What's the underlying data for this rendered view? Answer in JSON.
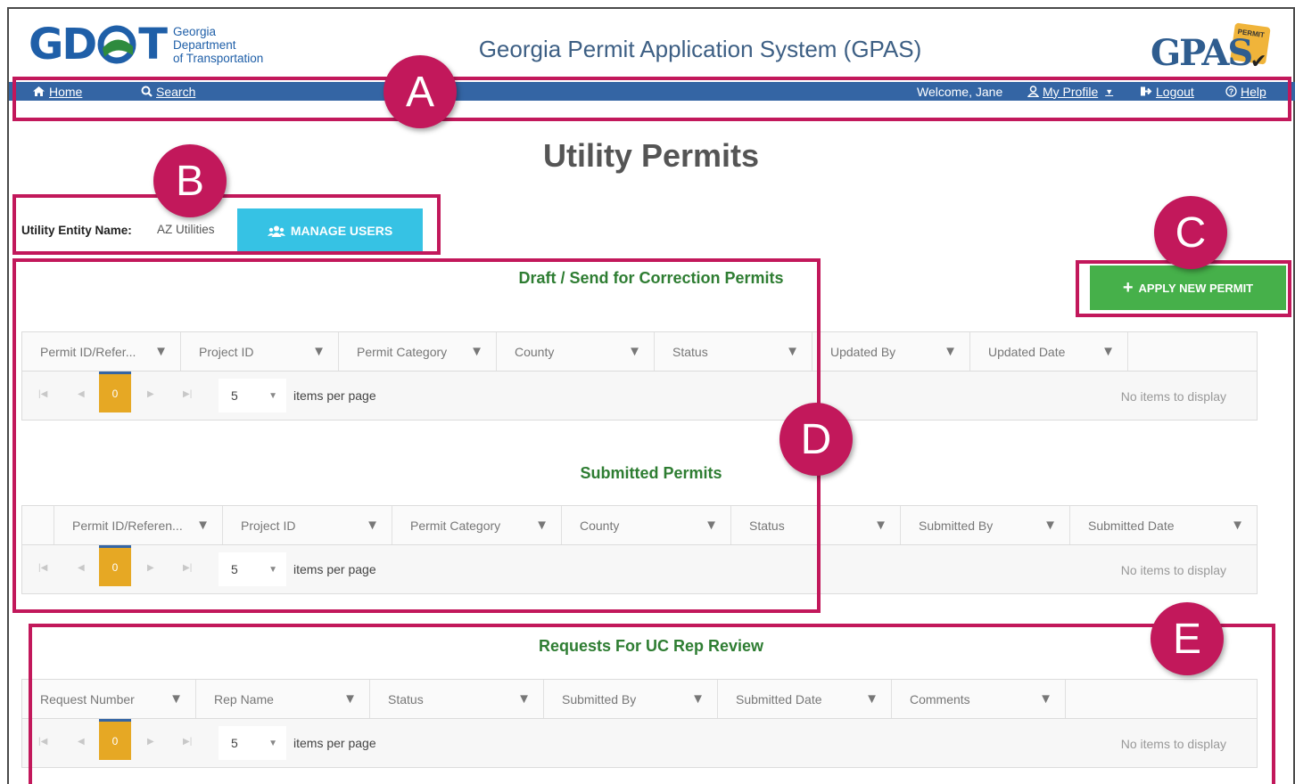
{
  "header": {
    "logo_letters_left": "GD",
    "logo_letters_right": "T",
    "logo_sub": [
      "Georgia",
      "Department",
      "of Transportation"
    ],
    "app_title": "Georgia Permit Application System (GPAS)",
    "gpas_logo_text": "GPAS",
    "gpas_logo_tag": "PERMIT"
  },
  "nav": {
    "home": "Home",
    "search": "Search",
    "welcome": "Welcome, Jane",
    "my_profile": "My Profile",
    "logout": "Logout",
    "help": "Help"
  },
  "page_title": "Utility Permits",
  "entity": {
    "label": "Utility Entity Name:",
    "value": "AZ Utilities",
    "manage_users": "MANAGE USERS"
  },
  "apply_new_permit": "APPLY NEW PERMIT",
  "sections": {
    "draft": {
      "title": "Draft / Send for Correction Permits",
      "columns": [
        "Permit ID/Refer...",
        "Project ID",
        "Permit Category",
        "County",
        "Status",
        "Updated By",
        "Updated Date"
      ]
    },
    "submitted": {
      "title": "Submitted Permits",
      "columns": [
        "Permit ID/Referen...",
        "Project ID",
        "Permit Category",
        "County",
        "Status",
        "Submitted By",
        "Submitted Date"
      ]
    },
    "rep_review": {
      "title": "Requests For UC Rep Review",
      "columns": [
        "Request Number",
        "Rep Name",
        "Status",
        "Submitted By",
        "Submitted Date",
        "Comments"
      ]
    }
  },
  "pager": {
    "current_page": "0",
    "page_size": "5",
    "items_per_page": "items per page",
    "no_items": "No items to display"
  },
  "callouts": [
    "A",
    "B",
    "C",
    "D",
    "E"
  ],
  "colors": {
    "nav_bg": "#3465a4",
    "callout": "#c2185b",
    "manage_btn": "#36c2e4",
    "apply_btn": "#46b04a",
    "section_title": "#2e7d32",
    "page_current": "#e6a824"
  },
  "icons": {
    "home": "home-icon",
    "search": "search-icon",
    "profile": "user-icon",
    "logout": "logout-icon",
    "help": "help-icon",
    "users": "users-icon",
    "plus": "plus-icon",
    "filter": "filter-icon"
  }
}
